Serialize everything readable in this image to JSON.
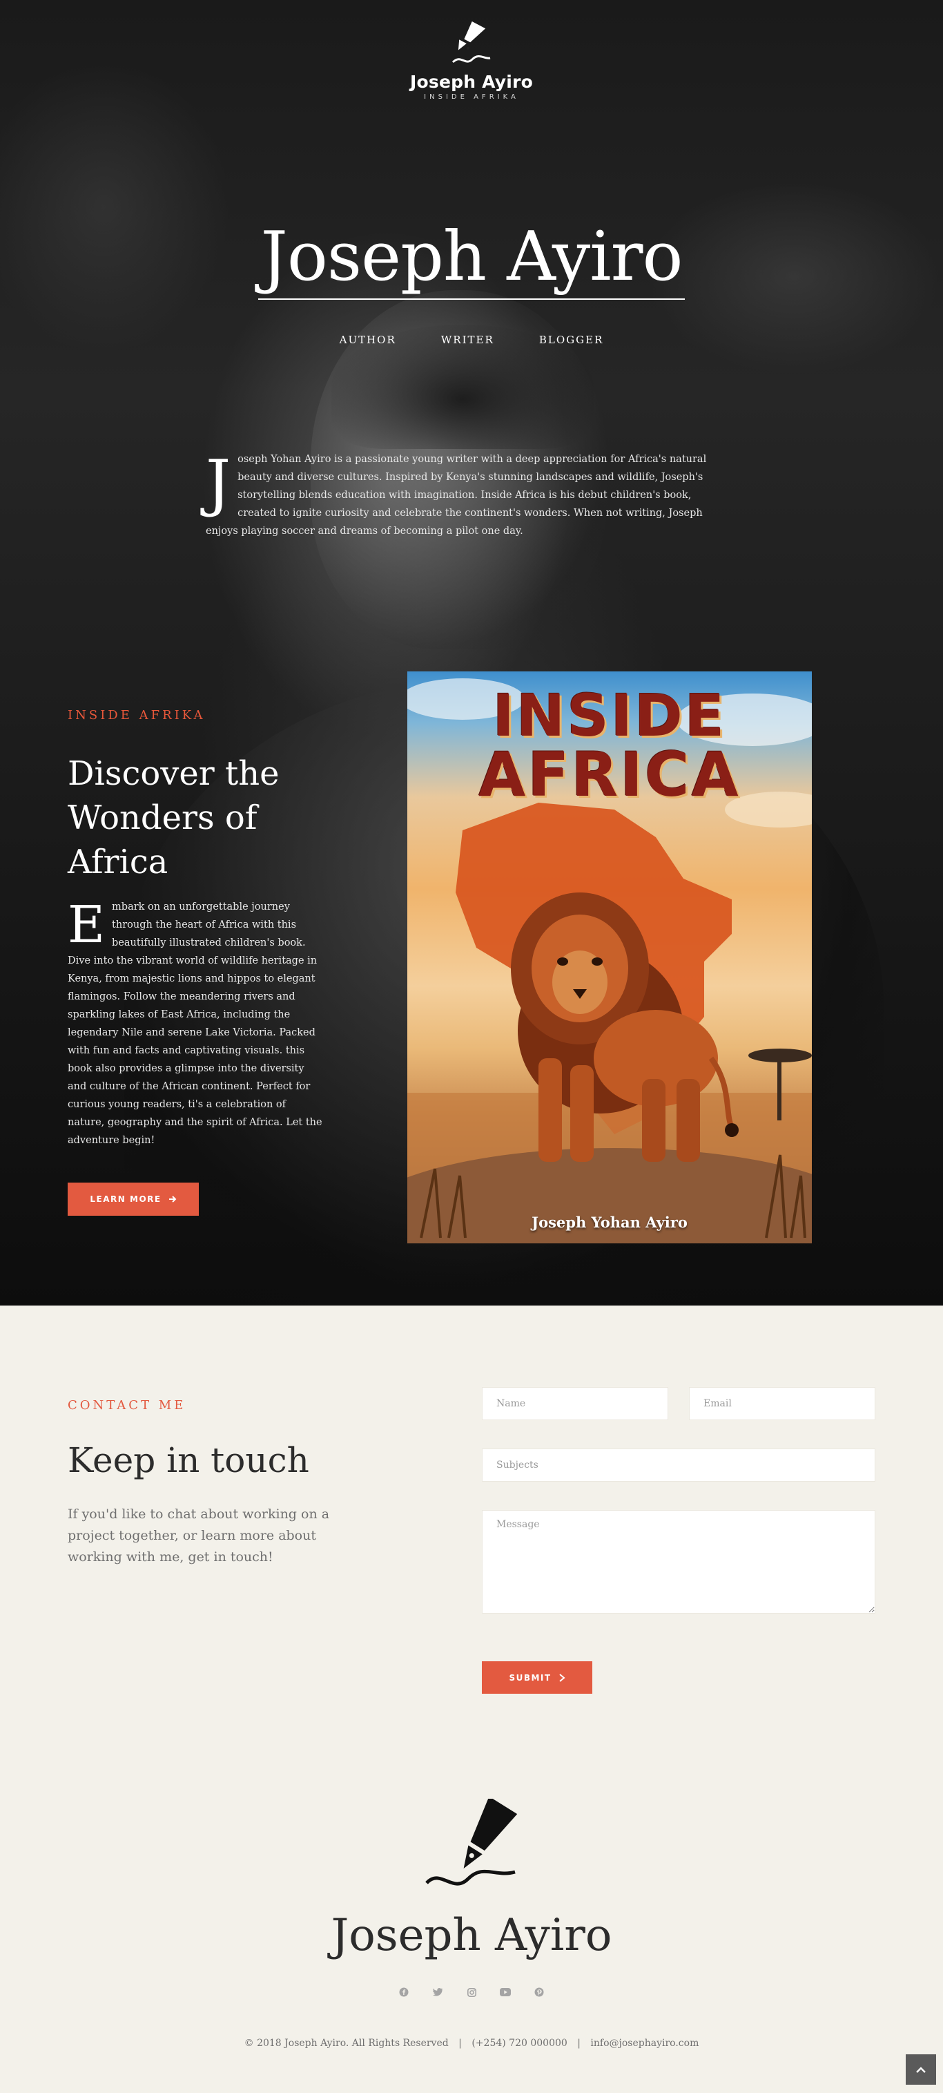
{
  "header": {
    "logo_name": "Joseph Ayiro",
    "logo_tagline": "INSIDE AFRIKA",
    "logo_icon": "fountain-pen-icon"
  },
  "hero": {
    "title": "Joseph Ayiro",
    "roles": [
      "AUTHOR",
      "WRITER",
      "BLOGGER"
    ],
    "bio_dropcap": "J",
    "bio_text": "oseph Yohan Ayiro is a passionate young writer with a deep appreciation for Africa's natural beauty and diverse cultures. Inspired by Kenya's stunning landscapes and wildlife, Joseph's storytelling blends education with imagination. Inside Africa is his debut children's book, created to ignite curiosity and celebrate the continent's wonders. When not writing, Joseph enjoys playing soccer and dreams of becoming a pilot one day."
  },
  "book": {
    "label": "INSIDE AFRIKA",
    "heading": "Discover the Wonders of Africa",
    "dropcap": "E",
    "text": "mbark on an unforgettable journey through the heart of Africa with this beautifully illustrated children's book. Dive into the vibrant world of wildlife heritage in Kenya, from majestic lions and hippos to elegant flamingos. Follow the meandering rivers and sparkling lakes of East Africa,  including the legendary Nile and serene Lake Victoria. Packed with fun and facts and captivating visuals. this book also provides a glimpse into the diversity and culture of the African continent. Perfect for curious young readers, ti's a celebration of nature, geography and the spirit of Africa. Let the adventure begin!",
    "button_label": "LEARN MORE",
    "button_icon": "arrow-right-icon",
    "cover": {
      "title_line1": "INSIDE",
      "title_line2": "AFRICA",
      "author": "Joseph Yohan Ayiro",
      "illustration": "lion-on-africa-map"
    }
  },
  "contact": {
    "label": "CONTACT ME",
    "heading": "Keep in touch",
    "text": "If you'd like to chat about working on a project together, or learn more about working with me, get in touch!",
    "name_placeholder": "Name",
    "email_placeholder": "Email",
    "subject_placeholder": "Subjects",
    "message_placeholder": "Message",
    "submit_label": "SUBMIT",
    "submit_icon": "chevron-right-icon"
  },
  "footer": {
    "name": "Joseph Ayiro",
    "social_icons": [
      "facebook-icon",
      "twitter-icon",
      "instagram-icon",
      "youtube-icon",
      "pinterest-icon"
    ],
    "copyright": "© 2018 Joseph Ayiro. All Rights Reserved",
    "phone": "(+254) 720 000000",
    "email": "info@josephayiro.com",
    "back_to_top_icon": "chevron-up-icon"
  },
  "colors": {
    "accent": "#e35a40",
    "hero_bg": "#1c1c1c",
    "page_bg": "#f3f1ea",
    "cover_title": "#8a1f16"
  }
}
